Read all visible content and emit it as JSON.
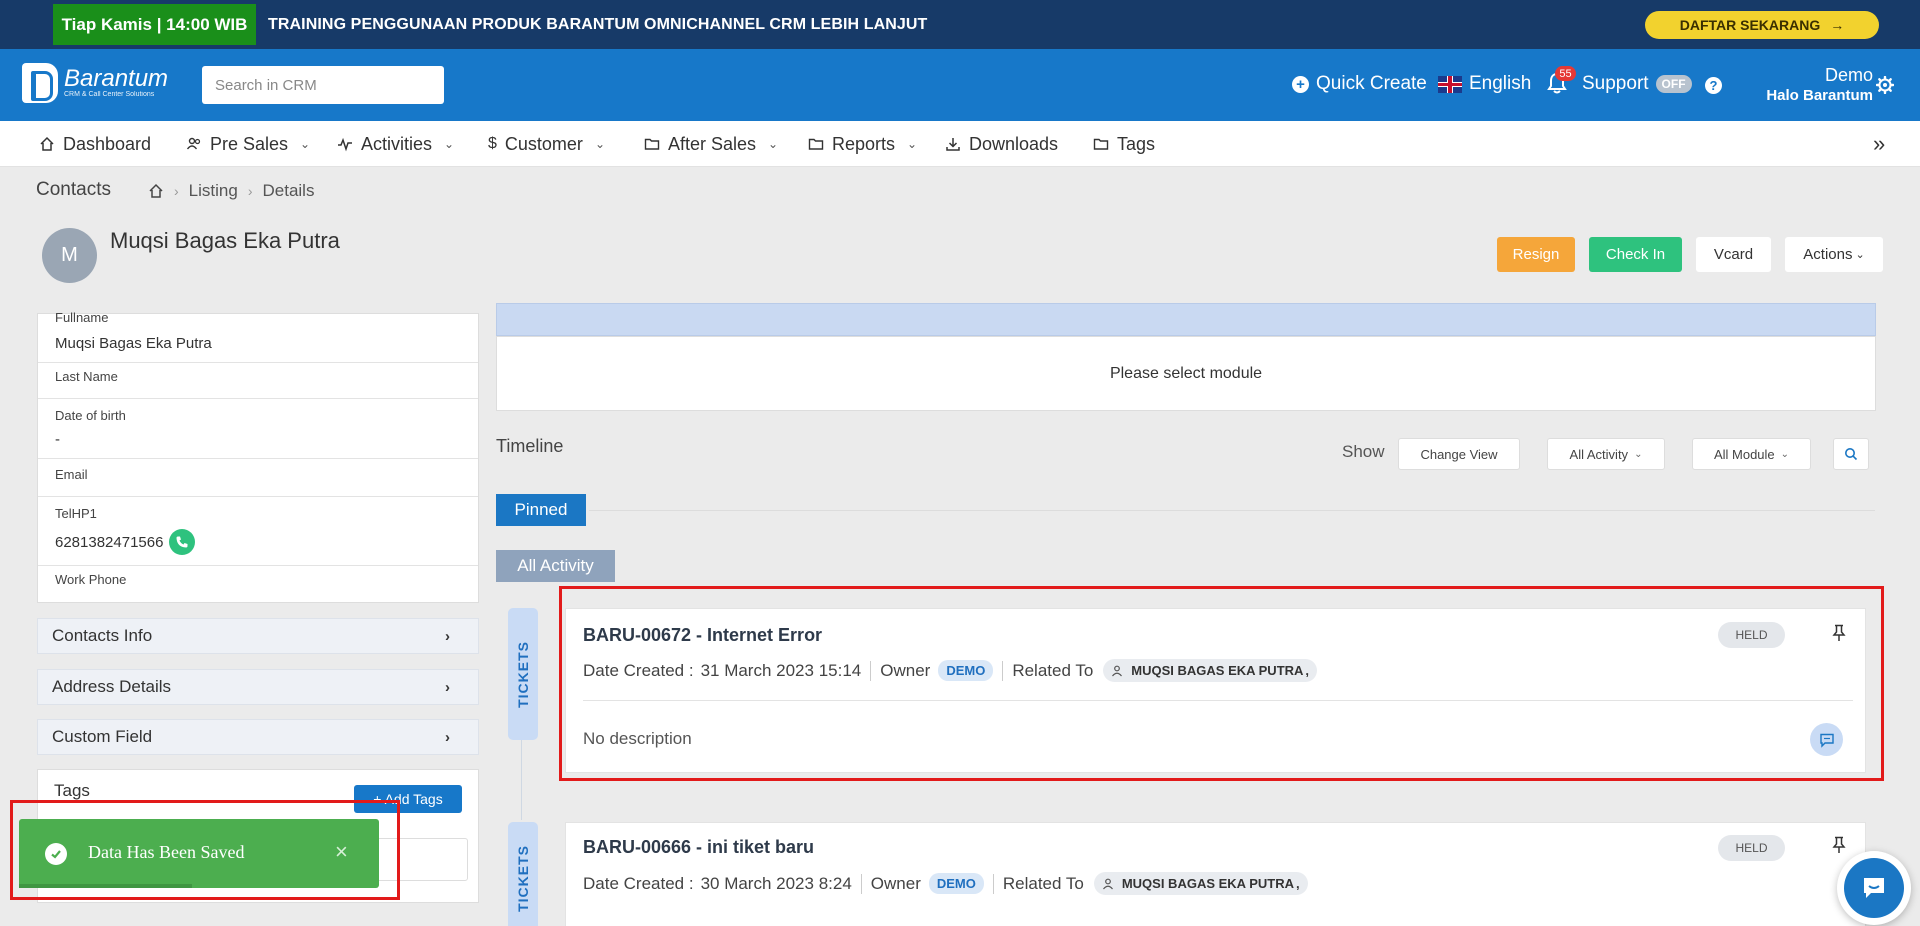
{
  "promo": {
    "badge": "Tiap Kamis | 14:00 WIB",
    "text": "TRAINING PENGGUNAAN PRODUK BARANTUM OMNICHANNEL CRM LEBIH LANJUT",
    "cta": "DAFTAR SEKARANG",
    "cta_arrow": "→"
  },
  "header": {
    "logo_name": "Barantum",
    "logo_tagline": "CRM & Call Center Solutions",
    "search_placeholder": "Search in CRM",
    "quick_create": "Quick Create",
    "language": "English",
    "notif_count": "55",
    "support": "Support",
    "support_status": "OFF",
    "help": "?",
    "user_name": "Demo",
    "user_org": "Halo Barantum"
  },
  "nav": {
    "items": [
      {
        "label": "Dashboard",
        "icon": "home-icon"
      },
      {
        "label": "Pre Sales",
        "icon": "users-icon"
      },
      {
        "label": "Activities",
        "icon": "activity-icon"
      },
      {
        "label": "Customer",
        "icon": "dollar-icon"
      },
      {
        "label": "After Sales",
        "icon": "folder-icon"
      },
      {
        "label": "Reports",
        "icon": "folder-icon"
      },
      {
        "label": "Downloads",
        "icon": "download-icon"
      },
      {
        "label": "Tags",
        "icon": "folder-icon"
      }
    ],
    "expand": "»"
  },
  "breadcrumb": {
    "title": "Contacts",
    "items": [
      "Listing",
      "Details"
    ]
  },
  "contact": {
    "initial": "M",
    "name": "Muqsi Bagas Eka Putra"
  },
  "actions": {
    "resign": "Resign",
    "check_in": "Check In",
    "vcard": "Vcard",
    "actions": "Actions"
  },
  "fields": [
    {
      "label": "Fullname",
      "value": "Muqsi Bagas Eka Putra"
    },
    {
      "label": "Last Name",
      "value": ""
    },
    {
      "label": "Date of birth",
      "value": "-"
    },
    {
      "label": "Email",
      "value": ""
    },
    {
      "label": "TelHP1",
      "value": "6281382471566"
    },
    {
      "label": "Work Phone",
      "value": ""
    }
  ],
  "sections": {
    "contacts_info": "Contacts Info",
    "address_details": "Address Details",
    "custom_field": "Custom Field",
    "tags": "Tags",
    "add_tags": "+ Add Tags"
  },
  "toast": {
    "message": "Data Has Been Saved",
    "close": "×",
    "progress": 0.48
  },
  "module": {
    "placeholder": "Please select module"
  },
  "timeline": {
    "title": "Timeline",
    "show": "Show",
    "change_view": "Change View",
    "activity_filter": "All Activity",
    "module_filter": "All Module",
    "pinned": "Pinned",
    "all_activity": "All Activity"
  },
  "tickets": [
    {
      "type": "TICKETS",
      "title": "BARU-00672 - Internet Error",
      "date_label": "Date Created :",
      "date": "31 March 2023 15:14",
      "owner_label": "Owner",
      "owner": "DEMO",
      "related_label": "Related To",
      "related": "MUQSI BAGAS EKA PUTRA",
      "related_suffix": ",",
      "status": "HELD",
      "description": "No description"
    },
    {
      "type": "TICKETS",
      "title": "BARU-00666 - ini tiket baru",
      "date_label": "Date Created :",
      "date": "30 March 2023 8:24",
      "owner_label": "Owner",
      "owner": "DEMO",
      "related_label": "Related To",
      "related": "MUQSI BAGAS EKA PUTRA",
      "related_suffix": ",",
      "status": "HELD"
    }
  ],
  "colors": {
    "brand": "#1778c9",
    "promo_bg": "#173a68",
    "promo_badge": "#1a8f1a",
    "cta": "#f2d22e",
    "success": "#4cae4f",
    "resign": "#f5a63a",
    "check_in": "#2ec27e",
    "highlight": "#e21a1a"
  }
}
